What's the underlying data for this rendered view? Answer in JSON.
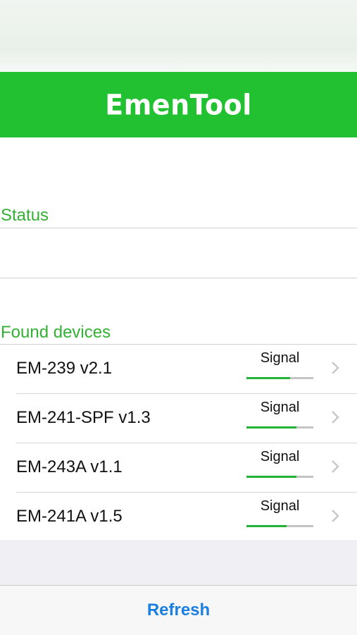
{
  "app": {
    "title": "EmenTool"
  },
  "sections": {
    "status_label": "Status",
    "found_devices_label": "Found devices"
  },
  "devices": [
    {
      "name": "EM-239 v2.1",
      "signal_label": "Signal",
      "signal_level": 0.65
    },
    {
      "name": "EM-241-SPF v1.3",
      "signal_label": "Signal",
      "signal_level": 0.75
    },
    {
      "name": "EM-243A v1.1",
      "signal_label": "Signal",
      "signal_level": 0.75
    },
    {
      "name": "EM-241A v1.5",
      "signal_label": "Signal",
      "signal_level": 0.6
    }
  ],
  "toolbar": {
    "refresh_label": "Refresh"
  },
  "colors": {
    "brand_green": "#22c132",
    "label_green": "#33b133",
    "link_blue": "#1a7fe0"
  },
  "icons": {
    "row_disclosure": "chevron-right-icon"
  }
}
